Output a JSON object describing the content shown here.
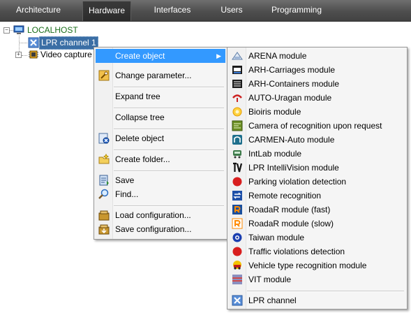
{
  "tabs": [
    {
      "label": "Architecture"
    },
    {
      "label": "Hardware",
      "active": true
    },
    {
      "label": "Interfaces"
    },
    {
      "label": "Users"
    },
    {
      "label": "Programming"
    }
  ],
  "tree": {
    "root_label": "LOCALHOST",
    "selected_item": "LPR channel 1",
    "other_item": "Video capture"
  },
  "context_menu": {
    "items": [
      {
        "label": "Create object"
      },
      {
        "label": "Change parameter..."
      },
      {
        "label": "Expand tree"
      },
      {
        "label": "Collapse tree"
      },
      {
        "label": "Delete object"
      },
      {
        "label": "Create folder..."
      },
      {
        "label": "Save"
      },
      {
        "label": "Find..."
      },
      {
        "label": "Load configuration..."
      },
      {
        "label": "Save configuration..."
      }
    ]
  },
  "submenu": {
    "items": [
      {
        "label": "ARENA module"
      },
      {
        "label": "ARH-Carriages module"
      },
      {
        "label": "ARH-Containers module"
      },
      {
        "label": "AUTO-Uragan module"
      },
      {
        "label": "Bioiris module"
      },
      {
        "label": "Camera of recognition upon request"
      },
      {
        "label": "CARMEN-Auto module"
      },
      {
        "label": "IntLab module"
      },
      {
        "label": "LPR IntelliVision module"
      },
      {
        "label": "Parking violation detection"
      },
      {
        "label": "Remote recognition"
      },
      {
        "label": "RoadaR module (fast)"
      },
      {
        "label": "RoadaR module (slow)"
      },
      {
        "label": "Taiwan module"
      },
      {
        "label": "Traffic violations detection"
      },
      {
        "label": "Vehicle type recognition module"
      },
      {
        "label": "VIT module"
      },
      {
        "label": "LPR channel"
      }
    ]
  },
  "colors": {
    "highlight": "#3399ff",
    "tree_selected": "#3a6ea5",
    "root_text": "#1a6e1a",
    "tabbar": "#4e4e4e"
  }
}
